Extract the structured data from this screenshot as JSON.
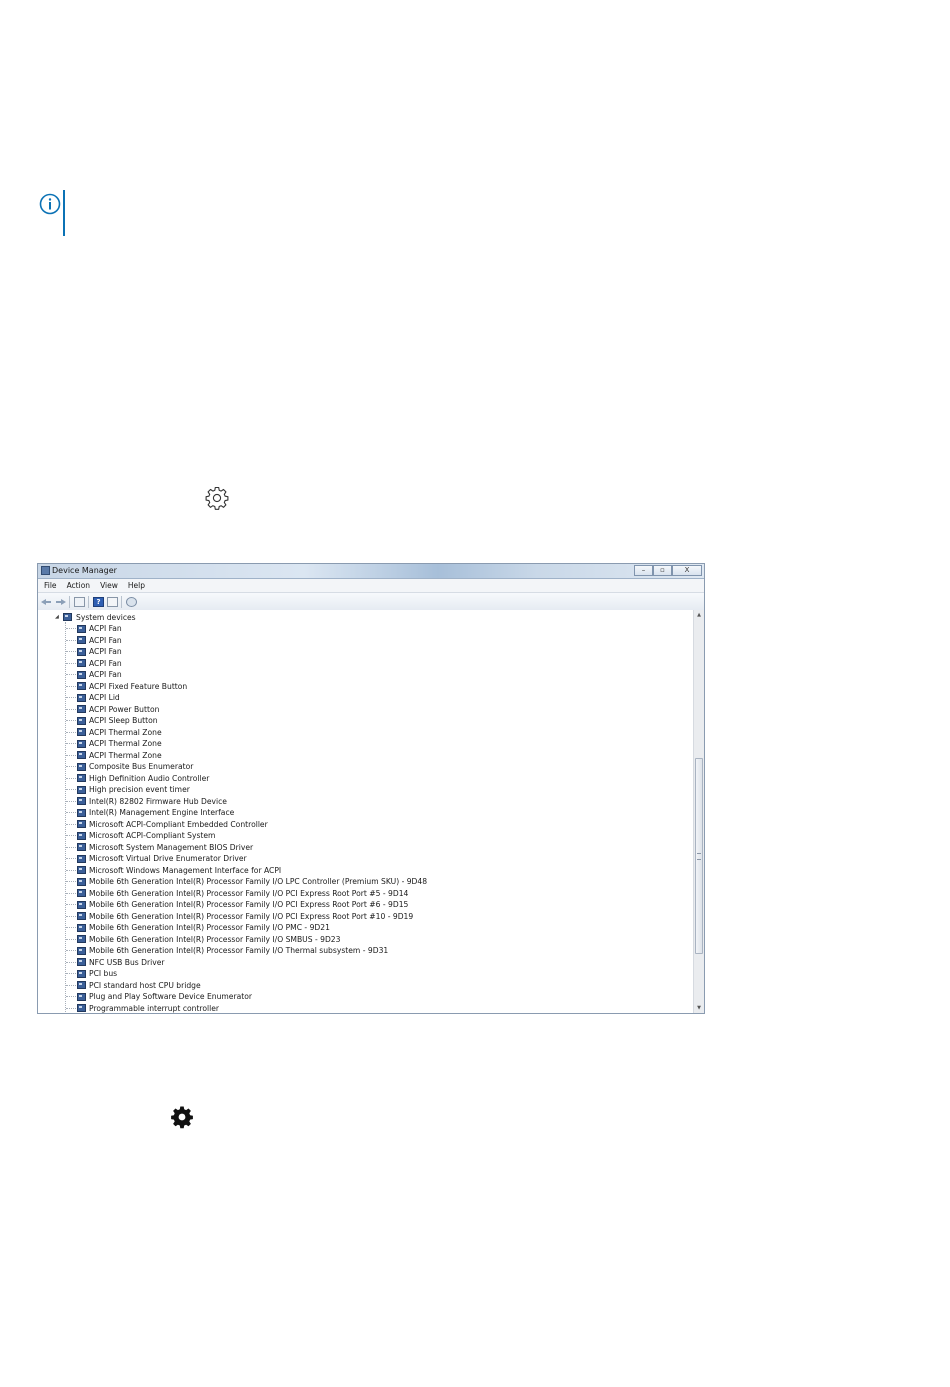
{
  "window": {
    "title": "Device Manager",
    "buttons": {
      "minimize": "–",
      "maximize": "▫",
      "close": "X"
    }
  },
  "menu": [
    "File",
    "Action",
    "View",
    "Help"
  ],
  "toolbar": {
    "icons": [
      "back-arrow-icon",
      "forward-arrow-icon",
      "properties-icon",
      "help-icon",
      "update-driver-icon",
      "scan-hardware-icon"
    ],
    "help_glyph": "?"
  },
  "tree": {
    "root": "System devices",
    "expander": "◢",
    "children": [
      "ACPI Fan",
      "ACPI Fan",
      "ACPI Fan",
      "ACPI Fan",
      "ACPI Fan",
      "ACPI Fixed Feature Button",
      "ACPI Lid",
      "ACPI Power Button",
      "ACPI Sleep Button",
      "ACPI Thermal Zone",
      "ACPI Thermal Zone",
      "ACPI Thermal Zone",
      "Composite Bus Enumerator",
      "High Definition Audio Controller",
      "High precision event timer",
      "Intel(R) 82802 Firmware Hub Device",
      "Intel(R) Management Engine Interface",
      "Microsoft ACPI-Compliant Embedded Controller",
      "Microsoft ACPI-Compliant System",
      "Microsoft System Management BIOS Driver",
      "Microsoft Virtual Drive Enumerator Driver",
      "Microsoft Windows Management Interface for ACPI",
      "Mobile 6th Generation Intel(R) Processor Family I/O LPC Controller (Premium SKU) - 9D48",
      "Mobile 6th Generation Intel(R) Processor Family I/O PCI Express Root Port #5 - 9D14",
      "Mobile 6th Generation Intel(R) Processor Family I/O PCI Express Root Port #6 - 9D15",
      "Mobile 6th Generation Intel(R) Processor Family I/O PCI Express Root Port #10 - 9D19",
      "Mobile 6th Generation Intel(R) Processor Family I/O PMC - 9D21",
      "Mobile 6th Generation Intel(R) Processor Family I/O SMBUS - 9D23",
      "Mobile 6th Generation Intel(R) Processor Family I/O Thermal subsystem - 9D31",
      "NFC USB Bus Driver",
      "PCI bus",
      "PCI standard host CPU bridge",
      "Plug and Play Software Device Enumerator",
      "Programmable interrupt controller"
    ]
  },
  "scrollbar": {
    "up": "▲",
    "down": "▼"
  },
  "page_icons": [
    "info-icon",
    "gear-outline-icon",
    "gear-solid-icon"
  ]
}
